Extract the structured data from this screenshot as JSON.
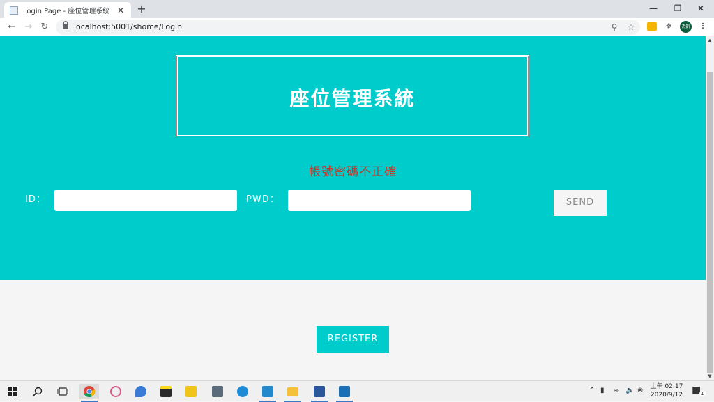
{
  "browser": {
    "tab_title": "Login Page - 座位管理系統",
    "new_tab": "+",
    "tab_close": "✕",
    "url": "localhost:5001/shome/Login",
    "window": {
      "minimize": "—",
      "restore": "❐",
      "close": "✕"
    },
    "profile_initials": "杰凱"
  },
  "page": {
    "app_title": "座位管理系統",
    "error_message": "帳號密碼不正確",
    "form": {
      "id_label": "ID：",
      "id_value": "",
      "pwd_label": "PWD：",
      "pwd_value": "",
      "send_label": "SEND"
    },
    "register_label": "REGISTER",
    "colors": {
      "primary": "#00cccc",
      "error": "#c0392b",
      "background": "#f5f5f5"
    }
  },
  "taskbar": {
    "clock_time": "上午 02:17",
    "clock_date": "2020/9/12",
    "notification_count": "1"
  }
}
